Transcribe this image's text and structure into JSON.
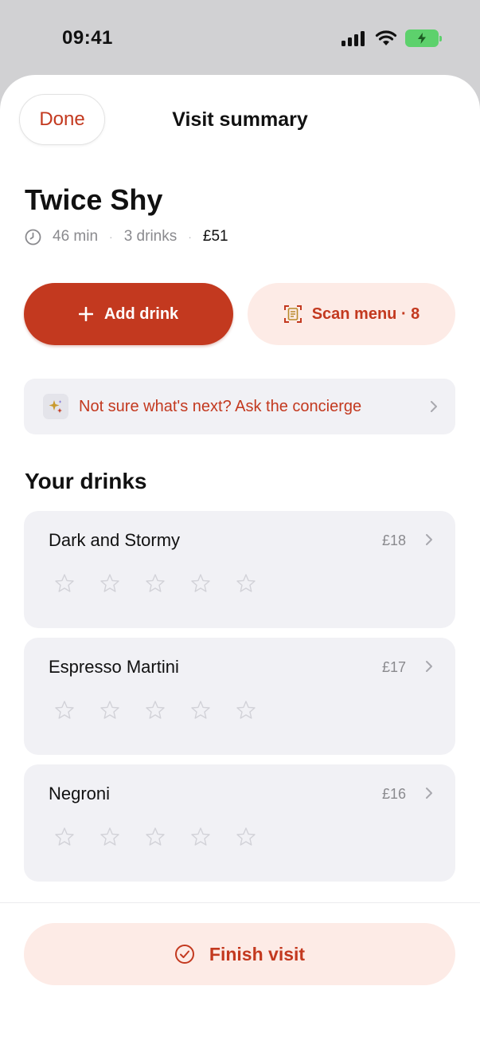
{
  "status_bar": {
    "time": "09:41"
  },
  "header": {
    "done_label": "Done",
    "title": "Visit summary"
  },
  "venue": {
    "name": "Twice Shy",
    "duration": "46 min",
    "drink_count": "3 drinks",
    "total": "£51"
  },
  "actions": {
    "add_drink_label": "Add drink",
    "scan_menu_label": "Scan menu · 8"
  },
  "concierge": {
    "text": "Not sure what's next? Ask the concierge"
  },
  "drinks_section": {
    "title": "Your drinks"
  },
  "drinks": [
    {
      "name": "Dark and Stormy",
      "price": "£18",
      "rating": 0,
      "max_rating": 5
    },
    {
      "name": "Espresso Martini",
      "price": "£17",
      "rating": 0,
      "max_rating": 5
    },
    {
      "name": "Negroni",
      "price": "£16",
      "rating": 0,
      "max_rating": 5
    }
  ],
  "footer": {
    "finish_label": "Finish visit"
  },
  "colors": {
    "accent": "#c3391f",
    "accent_soft": "#fdebe6",
    "card_bg": "#f1f1f5",
    "battery": "#5dd16c"
  },
  "icons": [
    "clock-icon",
    "plus-icon",
    "scan-menu-icon",
    "sparkles-icon",
    "chevron-right-icon",
    "star-outline-icon",
    "check-circle-icon",
    "signal-icon",
    "wifi-icon",
    "battery-charging-icon"
  ]
}
